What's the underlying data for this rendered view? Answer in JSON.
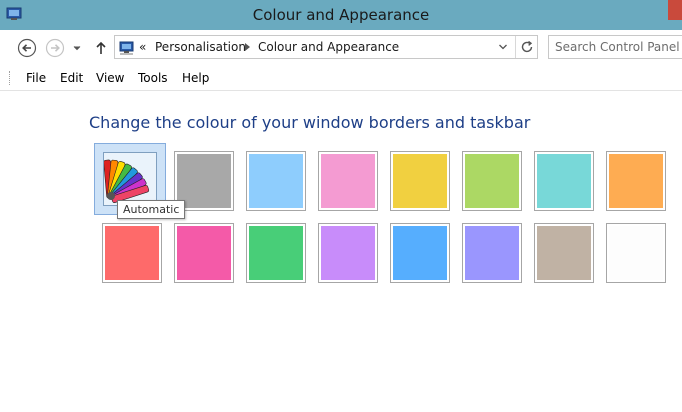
{
  "window": {
    "title": "Colour and Appearance"
  },
  "navigation": {
    "breadcrumb_prefix": "«",
    "breadcrumb": [
      "Personalisation",
      "Colour and Appearance"
    ],
    "search_placeholder": "Search Control Panel"
  },
  "menubar": {
    "items": [
      "File",
      "Edit",
      "View",
      "Tools",
      "Help"
    ]
  },
  "main": {
    "heading": "Change the colour of your window borders and taskbar",
    "tooltip": "Automatic",
    "swatches": [
      {
        "name": "Automatic",
        "color": "",
        "selected": true
      },
      {
        "color": "#a8a8a8"
      },
      {
        "color": "#8ecdfd"
      },
      {
        "color": "#f49bd2"
      },
      {
        "color": "#f1d040"
      },
      {
        "color": "#acd864"
      },
      {
        "color": "#78d8d8"
      },
      {
        "color": "#feac52"
      },
      {
        "color": "#fe6a6a"
      },
      {
        "color": "#f45aa8"
      },
      {
        "color": "#48ce78"
      },
      {
        "color": "#c88cfa"
      },
      {
        "color": "#56aefe"
      },
      {
        "color": "#9a96fe"
      },
      {
        "color": "#c0b2a4"
      },
      {
        "color": "#fdfdfd"
      }
    ]
  }
}
